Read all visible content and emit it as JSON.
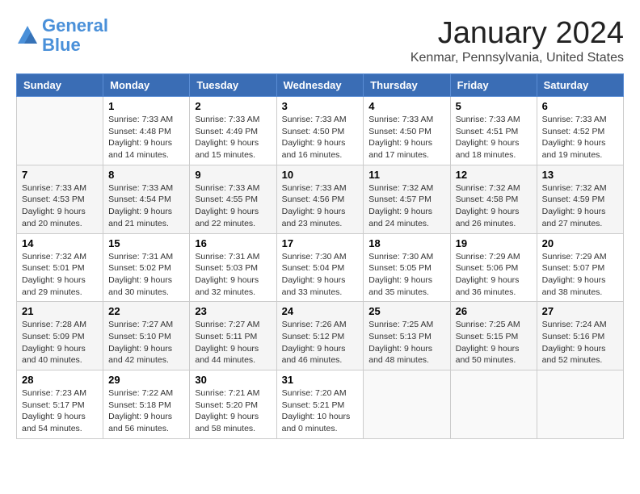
{
  "header": {
    "logo_line1": "General",
    "logo_line2": "Blue",
    "title": "January 2024",
    "subtitle": "Kenmar, Pennsylvania, United States"
  },
  "weekdays": [
    "Sunday",
    "Monday",
    "Tuesday",
    "Wednesday",
    "Thursday",
    "Friday",
    "Saturday"
  ],
  "weeks": [
    [
      {
        "day": "",
        "info": ""
      },
      {
        "day": "1",
        "info": "Sunrise: 7:33 AM\nSunset: 4:48 PM\nDaylight: 9 hours\nand 14 minutes."
      },
      {
        "day": "2",
        "info": "Sunrise: 7:33 AM\nSunset: 4:49 PM\nDaylight: 9 hours\nand 15 minutes."
      },
      {
        "day": "3",
        "info": "Sunrise: 7:33 AM\nSunset: 4:50 PM\nDaylight: 9 hours\nand 16 minutes."
      },
      {
        "day": "4",
        "info": "Sunrise: 7:33 AM\nSunset: 4:50 PM\nDaylight: 9 hours\nand 17 minutes."
      },
      {
        "day": "5",
        "info": "Sunrise: 7:33 AM\nSunset: 4:51 PM\nDaylight: 9 hours\nand 18 minutes."
      },
      {
        "day": "6",
        "info": "Sunrise: 7:33 AM\nSunset: 4:52 PM\nDaylight: 9 hours\nand 19 minutes."
      }
    ],
    [
      {
        "day": "7",
        "info": "Sunrise: 7:33 AM\nSunset: 4:53 PM\nDaylight: 9 hours\nand 20 minutes."
      },
      {
        "day": "8",
        "info": "Sunrise: 7:33 AM\nSunset: 4:54 PM\nDaylight: 9 hours\nand 21 minutes."
      },
      {
        "day": "9",
        "info": "Sunrise: 7:33 AM\nSunset: 4:55 PM\nDaylight: 9 hours\nand 22 minutes."
      },
      {
        "day": "10",
        "info": "Sunrise: 7:33 AM\nSunset: 4:56 PM\nDaylight: 9 hours\nand 23 minutes."
      },
      {
        "day": "11",
        "info": "Sunrise: 7:32 AM\nSunset: 4:57 PM\nDaylight: 9 hours\nand 24 minutes."
      },
      {
        "day": "12",
        "info": "Sunrise: 7:32 AM\nSunset: 4:58 PM\nDaylight: 9 hours\nand 26 minutes."
      },
      {
        "day": "13",
        "info": "Sunrise: 7:32 AM\nSunset: 4:59 PM\nDaylight: 9 hours\nand 27 minutes."
      }
    ],
    [
      {
        "day": "14",
        "info": "Sunrise: 7:32 AM\nSunset: 5:01 PM\nDaylight: 9 hours\nand 29 minutes."
      },
      {
        "day": "15",
        "info": "Sunrise: 7:31 AM\nSunset: 5:02 PM\nDaylight: 9 hours\nand 30 minutes."
      },
      {
        "day": "16",
        "info": "Sunrise: 7:31 AM\nSunset: 5:03 PM\nDaylight: 9 hours\nand 32 minutes."
      },
      {
        "day": "17",
        "info": "Sunrise: 7:30 AM\nSunset: 5:04 PM\nDaylight: 9 hours\nand 33 minutes."
      },
      {
        "day": "18",
        "info": "Sunrise: 7:30 AM\nSunset: 5:05 PM\nDaylight: 9 hours\nand 35 minutes."
      },
      {
        "day": "19",
        "info": "Sunrise: 7:29 AM\nSunset: 5:06 PM\nDaylight: 9 hours\nand 36 minutes."
      },
      {
        "day": "20",
        "info": "Sunrise: 7:29 AM\nSunset: 5:07 PM\nDaylight: 9 hours\nand 38 minutes."
      }
    ],
    [
      {
        "day": "21",
        "info": "Sunrise: 7:28 AM\nSunset: 5:09 PM\nDaylight: 9 hours\nand 40 minutes."
      },
      {
        "day": "22",
        "info": "Sunrise: 7:27 AM\nSunset: 5:10 PM\nDaylight: 9 hours\nand 42 minutes."
      },
      {
        "day": "23",
        "info": "Sunrise: 7:27 AM\nSunset: 5:11 PM\nDaylight: 9 hours\nand 44 minutes."
      },
      {
        "day": "24",
        "info": "Sunrise: 7:26 AM\nSunset: 5:12 PM\nDaylight: 9 hours\nand 46 minutes."
      },
      {
        "day": "25",
        "info": "Sunrise: 7:25 AM\nSunset: 5:13 PM\nDaylight: 9 hours\nand 48 minutes."
      },
      {
        "day": "26",
        "info": "Sunrise: 7:25 AM\nSunset: 5:15 PM\nDaylight: 9 hours\nand 50 minutes."
      },
      {
        "day": "27",
        "info": "Sunrise: 7:24 AM\nSunset: 5:16 PM\nDaylight: 9 hours\nand 52 minutes."
      }
    ],
    [
      {
        "day": "28",
        "info": "Sunrise: 7:23 AM\nSunset: 5:17 PM\nDaylight: 9 hours\nand 54 minutes."
      },
      {
        "day": "29",
        "info": "Sunrise: 7:22 AM\nSunset: 5:18 PM\nDaylight: 9 hours\nand 56 minutes."
      },
      {
        "day": "30",
        "info": "Sunrise: 7:21 AM\nSunset: 5:20 PM\nDaylight: 9 hours\nand 58 minutes."
      },
      {
        "day": "31",
        "info": "Sunrise: 7:20 AM\nSunset: 5:21 PM\nDaylight: 10 hours\nand 0 minutes."
      },
      {
        "day": "",
        "info": ""
      },
      {
        "day": "",
        "info": ""
      },
      {
        "day": "",
        "info": ""
      }
    ]
  ]
}
